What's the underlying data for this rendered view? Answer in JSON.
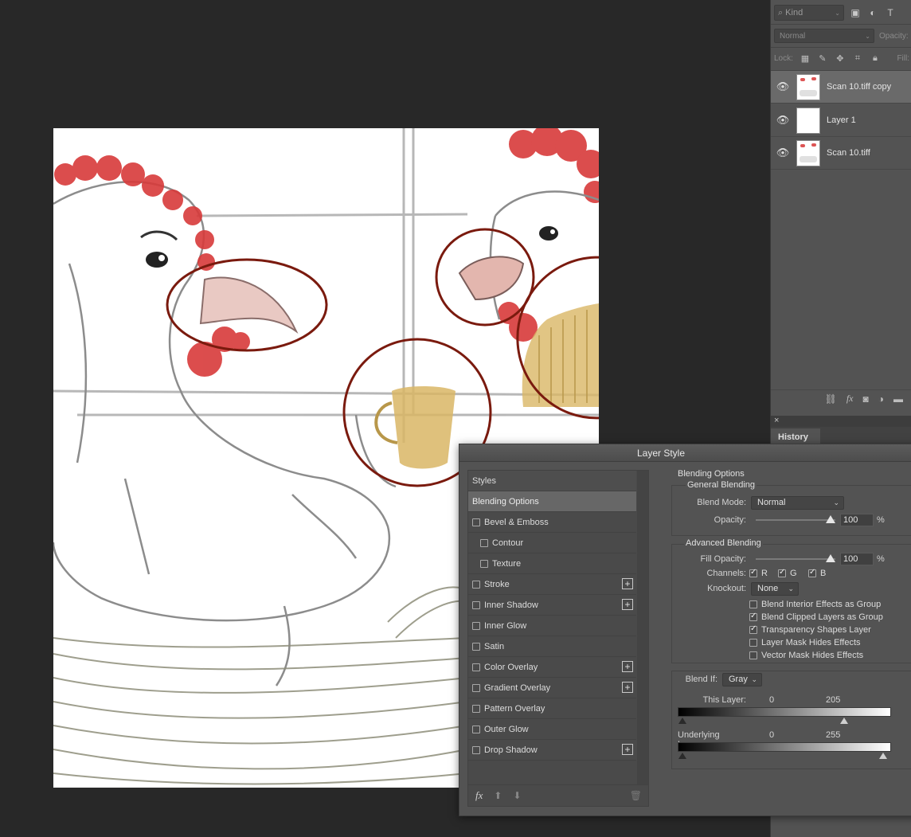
{
  "layers_panel": {
    "filter_kind": "Kind",
    "blend_mode": "Normal",
    "opacity_label": "Opacity:",
    "lock_label": "Lock:",
    "fill_label": "Fill:",
    "layers": [
      {
        "name": "Scan 10.tiff copy",
        "selected": true
      },
      {
        "name": "Layer 1",
        "selected": false
      },
      {
        "name": "Scan 10.tiff",
        "selected": false
      }
    ]
  },
  "history_panel": {
    "tab": "History"
  },
  "layer_style": {
    "title": "Layer Style",
    "styles_header": "Styles",
    "items": [
      {
        "label": "Blending Options",
        "checkbox": false,
        "indent": false,
        "plus": false,
        "selected": true
      },
      {
        "label": "Bevel & Emboss",
        "checkbox": true,
        "indent": false,
        "plus": false
      },
      {
        "label": "Contour",
        "checkbox": true,
        "indent": true,
        "plus": false
      },
      {
        "label": "Texture",
        "checkbox": true,
        "indent": true,
        "plus": false
      },
      {
        "label": "Stroke",
        "checkbox": true,
        "indent": false,
        "plus": true
      },
      {
        "label": "Inner Shadow",
        "checkbox": true,
        "indent": false,
        "plus": true
      },
      {
        "label": "Inner Glow",
        "checkbox": true,
        "indent": false,
        "plus": false
      },
      {
        "label": "Satin",
        "checkbox": true,
        "indent": false,
        "plus": false
      },
      {
        "label": "Color Overlay",
        "checkbox": true,
        "indent": false,
        "plus": true
      },
      {
        "label": "Gradient Overlay",
        "checkbox": true,
        "indent": false,
        "plus": true
      },
      {
        "label": "Pattern Overlay",
        "checkbox": true,
        "indent": false,
        "plus": false
      },
      {
        "label": "Outer Glow",
        "checkbox": true,
        "indent": false,
        "plus": false
      },
      {
        "label": "Drop Shadow",
        "checkbox": true,
        "indent": false,
        "plus": true
      }
    ],
    "fx_label": "fx",
    "blending": {
      "section_title": "Blending Options",
      "general_title": "General Blending",
      "blend_mode_label": "Blend Mode:",
      "blend_mode_value": "Normal",
      "opacity_label": "Opacity:",
      "opacity_value": "100",
      "pct": "%",
      "advanced_title": "Advanced Blending",
      "fill_opacity_label": "Fill Opacity:",
      "fill_opacity_value": "100",
      "channels_label": "Channels:",
      "channels": [
        "R",
        "G",
        "B"
      ],
      "knockout_label": "Knockout:",
      "knockout_value": "None",
      "options": [
        {
          "label": "Blend Interior Effects as Group",
          "checked": false
        },
        {
          "label": "Blend Clipped Layers as Group",
          "checked": true
        },
        {
          "label": "Transparency Shapes Layer",
          "checked": true
        },
        {
          "label": "Layer Mask Hides Effects",
          "checked": false
        },
        {
          "label": "Vector Mask Hides Effects",
          "checked": false
        }
      ],
      "blend_if_label": "Blend If:",
      "blend_if_value": "Gray",
      "this_layer_label": "This Layer:",
      "this_layer_low": "0",
      "this_layer_high": "205",
      "underlying_label": "Underlying Layer:",
      "underlying_low": "0",
      "underlying_high": "255"
    }
  },
  "colors": {
    "circle": "#7a1a0e",
    "comb": "#d83a3a",
    "mustard": "#d9b665",
    "pencil": "#9a9a9a"
  }
}
